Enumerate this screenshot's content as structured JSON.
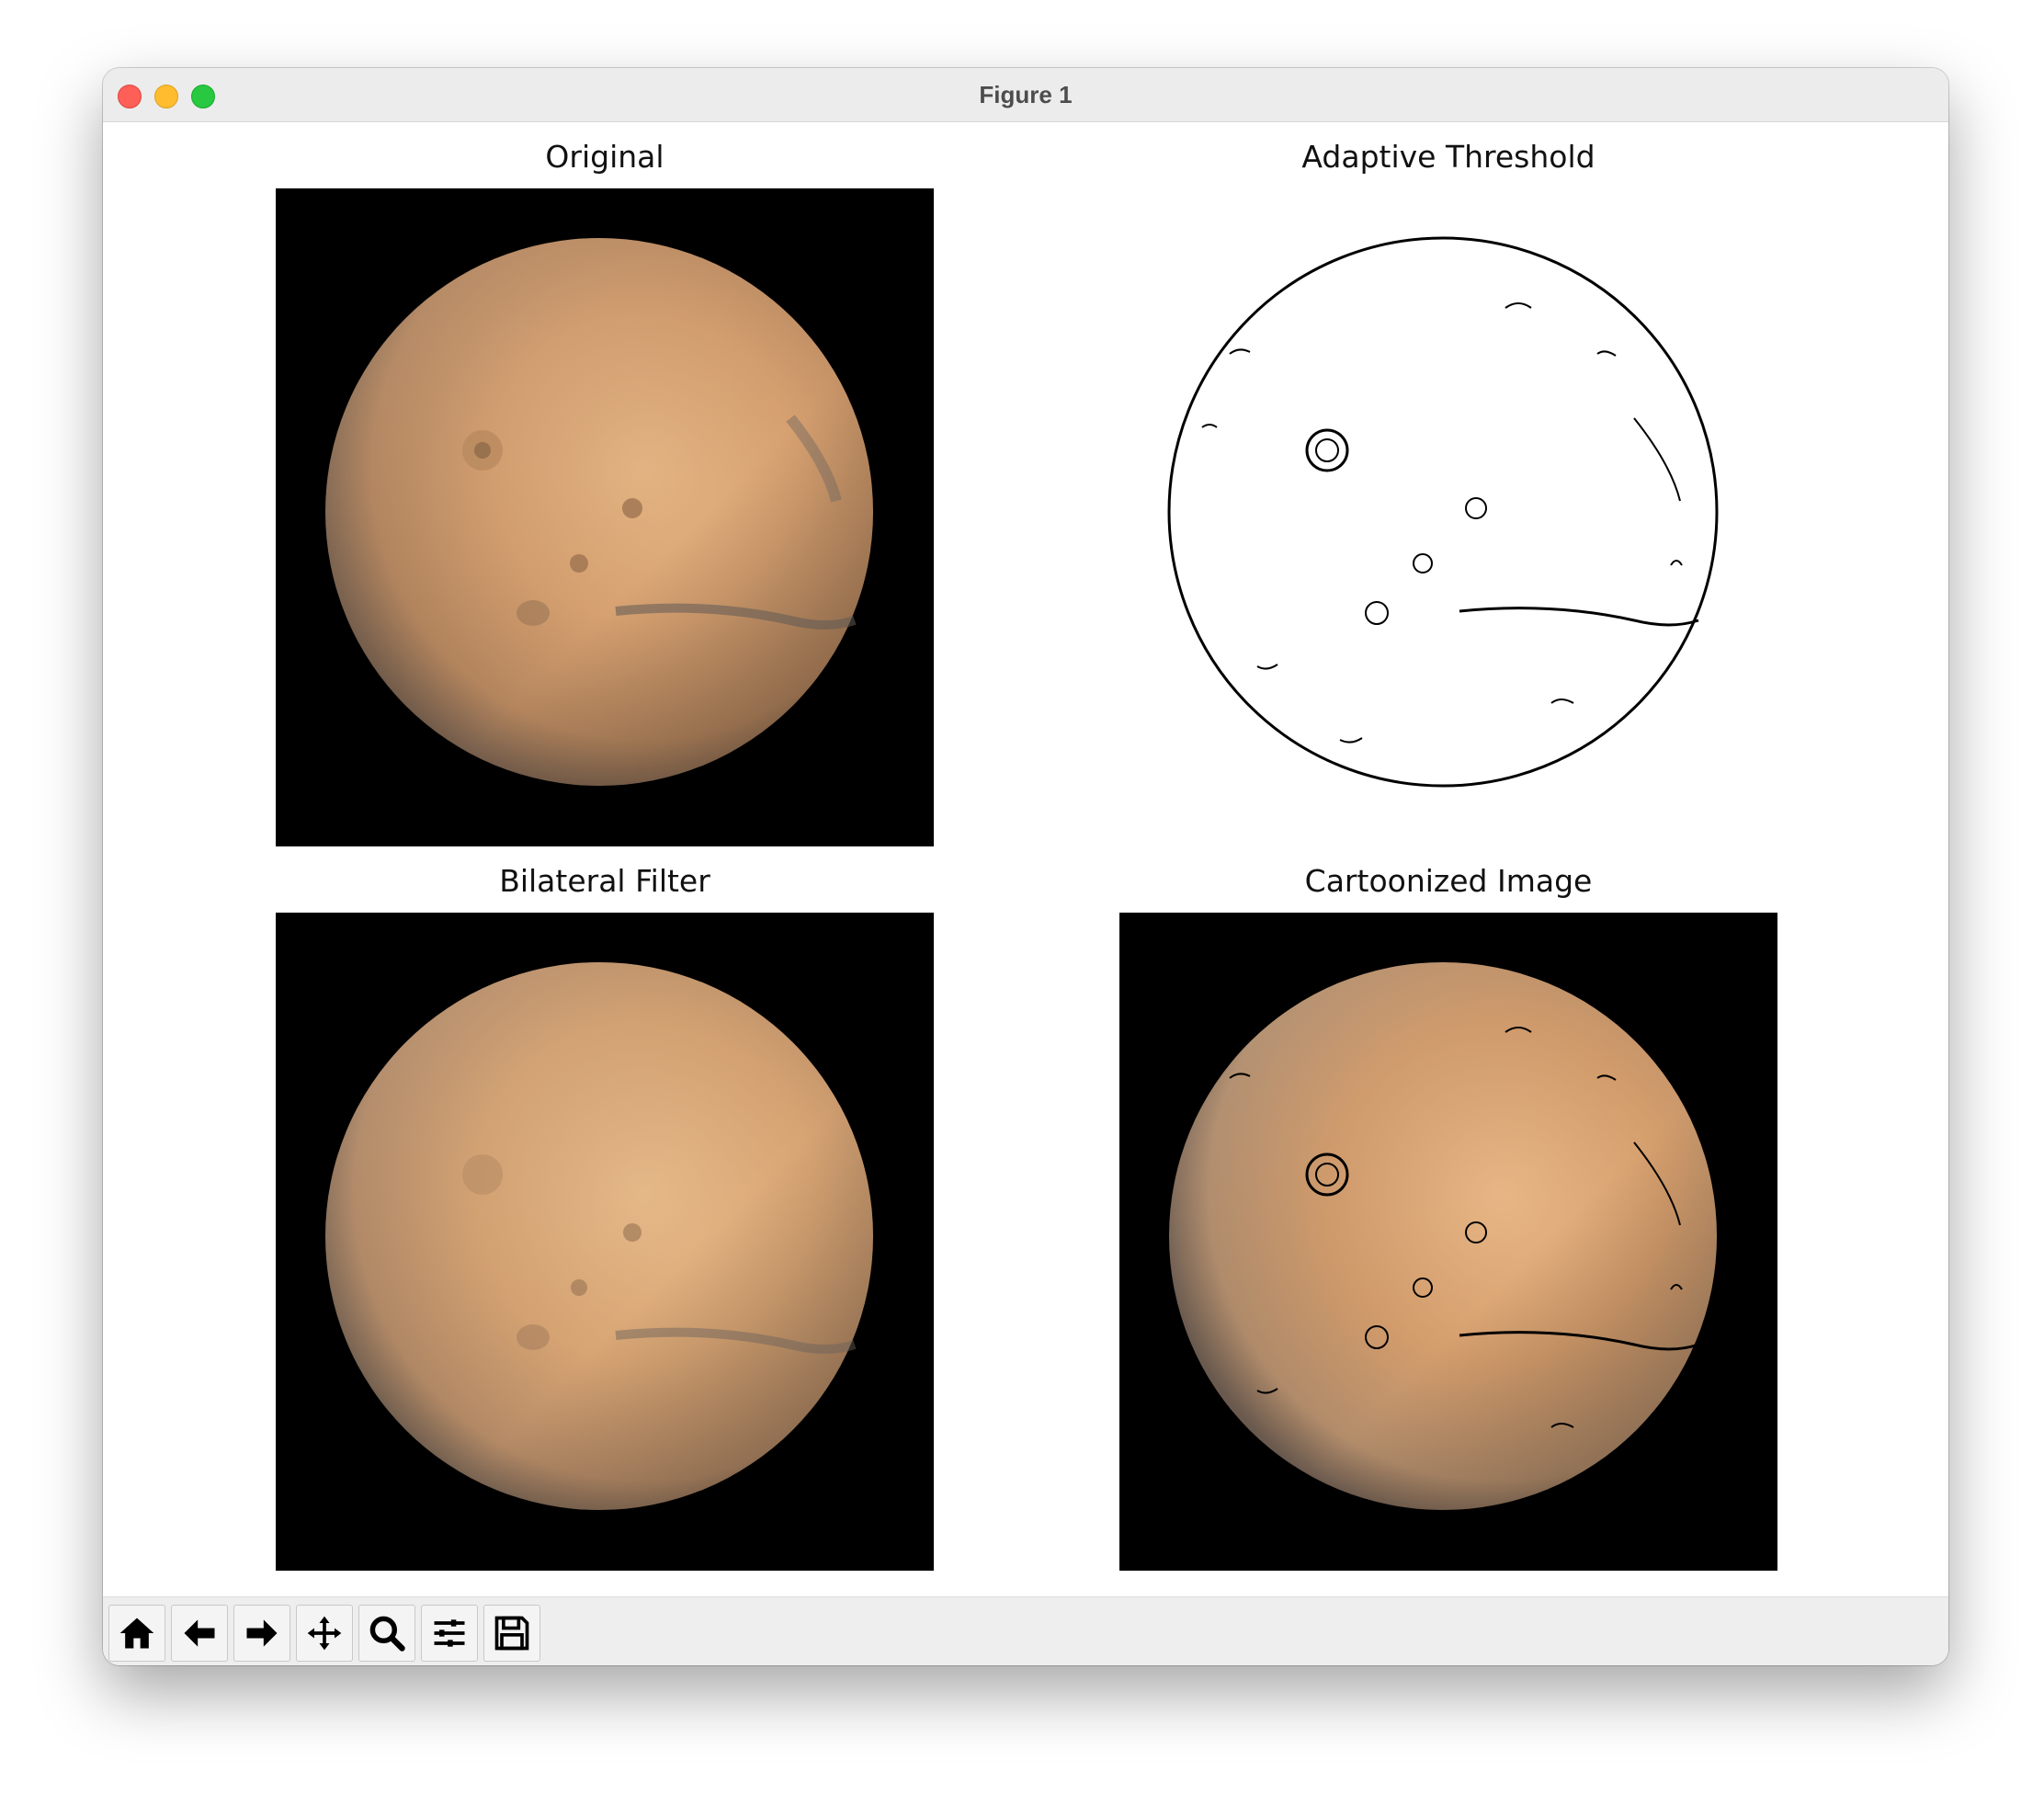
{
  "window": {
    "title": "Figure 1"
  },
  "panels": [
    {
      "title": "Original",
      "image": "mars-original"
    },
    {
      "title": "Adaptive Threshold",
      "image": "mars-adaptive-threshold"
    },
    {
      "title": "Bilateral Filter",
      "image": "mars-bilateral-filter"
    },
    {
      "title": "Cartoonized Image",
      "image": "mars-cartoonized"
    }
  ],
  "toolbar": {
    "buttons": [
      {
        "icon": "home-icon",
        "label": "Home"
      },
      {
        "icon": "back-arrow-icon",
        "label": "Back"
      },
      {
        "icon": "forward-arrow-icon",
        "label": "Forward"
      },
      {
        "icon": "pan-move-icon",
        "label": "Pan"
      },
      {
        "icon": "zoom-magnifier-icon",
        "label": "Zoom"
      },
      {
        "icon": "configure-subplots-icon",
        "label": "Subplots"
      },
      {
        "icon": "save-floppy-icon",
        "label": "Save"
      }
    ]
  },
  "colors": {
    "close": "#fe5f57",
    "minimize": "#febc2e",
    "maximize": "#28c840",
    "planet": "#d9a470",
    "background": "#000000"
  }
}
